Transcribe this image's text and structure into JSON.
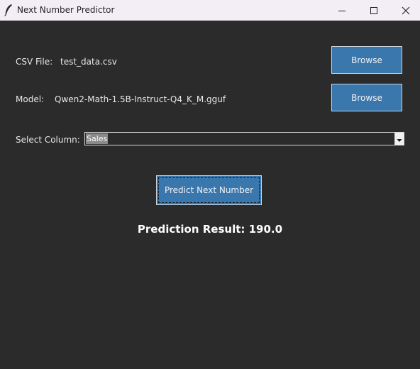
{
  "window": {
    "title": "Next Number Predictor",
    "app_icon": "feather-icon",
    "controls": [
      "minimize-icon",
      "maximize-icon",
      "close-icon"
    ]
  },
  "csv_file": {
    "label": "CSV File:",
    "value": "test_data.csv",
    "browse_label": "Browse"
  },
  "model": {
    "label": "Model:",
    "value": "Qwen2-Math-1.5B-Instruct-Q4_K_M.gguf",
    "browse_label": "Browse"
  },
  "column_select": {
    "label": "Select Column:",
    "value": "Sales"
  },
  "predict_button": {
    "label": "Predict Next Number"
  },
  "result": {
    "text": "Prediction Result: 190.0"
  },
  "colors": {
    "background": "#2b2b2b",
    "titlebar": "#f3eef6",
    "button": "#3a77ad",
    "text": "#e8e8e8"
  }
}
